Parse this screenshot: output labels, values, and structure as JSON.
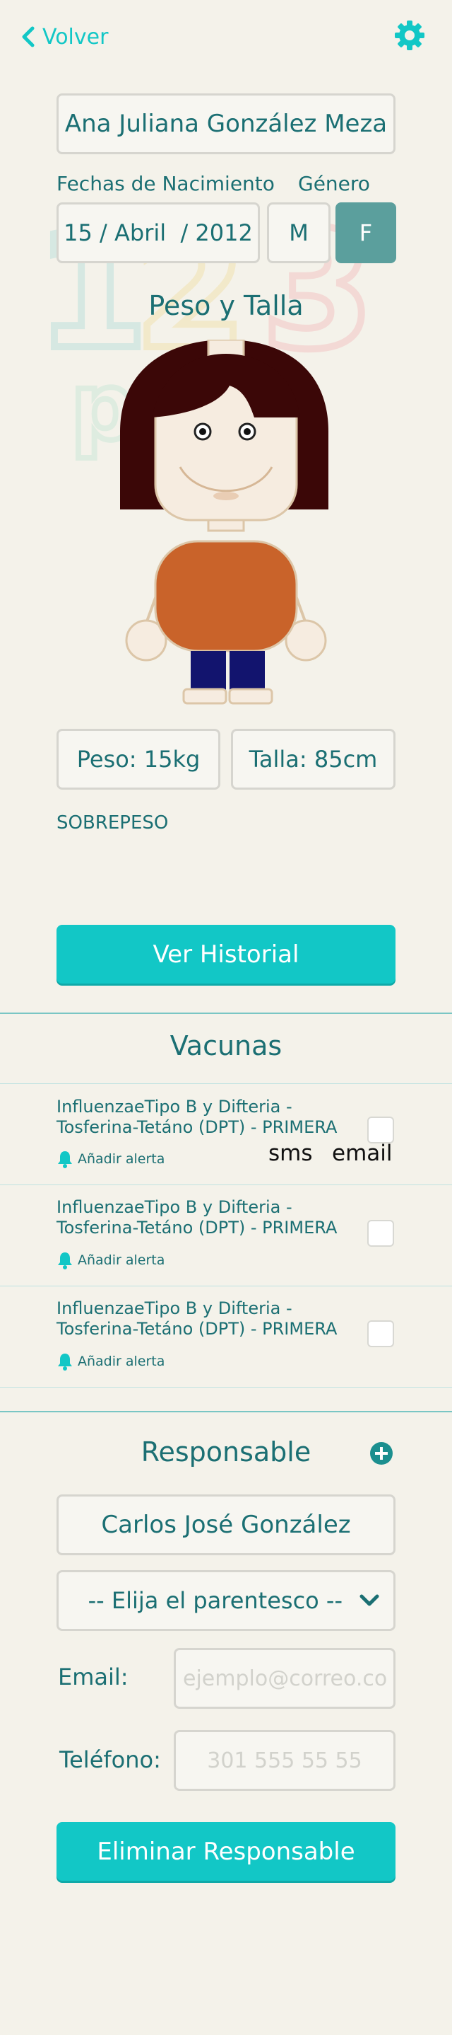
{
  "nav": {
    "back_label": "Volver"
  },
  "profile": {
    "name": "Ana Juliana González Meza",
    "birth_label": "Fechas de Nacimiento",
    "birth_date": "15 / Abril  / 2012",
    "gender_label": "Género",
    "gender_m": "M",
    "gender_f": "F",
    "gender_selected": "F"
  },
  "body": {
    "title": "Peso y Talla",
    "weight": "Peso: 15kg",
    "height": "Talla: 85cm",
    "status": "SOBREPESO"
  },
  "history_button": "Ver Historial",
  "vaccines": {
    "title": "Vacunas",
    "col_sms": "sms",
    "col_email": "email",
    "items": [
      {
        "line1": "InfluenzaeTipo B y Difteria -",
        "line2": "Tosferina-Tetáno (DPT) - PRIMERA",
        "alert": "Añadir alerta"
      },
      {
        "line1": "InfluenzaeTipo B y Difteria -",
        "line2": "Tosferina-Tetáno (DPT) - PRIMERA",
        "alert": "Añadir alerta"
      },
      {
        "line1": "InfluenzaeTipo B y Difteria -",
        "line2": "Tosferina-Tetáno (DPT) - PRIMERA",
        "alert": "Añadir alerta"
      }
    ]
  },
  "guardian": {
    "title": "Responsable",
    "name": "Carlos José González",
    "relationship_placeholder": "-- Elija el parentesco --",
    "email_label": "Email:",
    "email_placeholder": "ejemplo@correo.co",
    "phone_label": "Teléfono:",
    "phone_placeholder": "301 555 55 55",
    "delete_button": "Eliminar Responsable"
  },
  "colors": {
    "accent": "#12c7c6",
    "text": "#1b6f73",
    "gender_selected_bg": "#5b9f9d",
    "background": "#f4f2ea",
    "hair": "#3b0707",
    "shirt": "#c9632a",
    "pants": "#12146e"
  },
  "watermark": "123 pum"
}
